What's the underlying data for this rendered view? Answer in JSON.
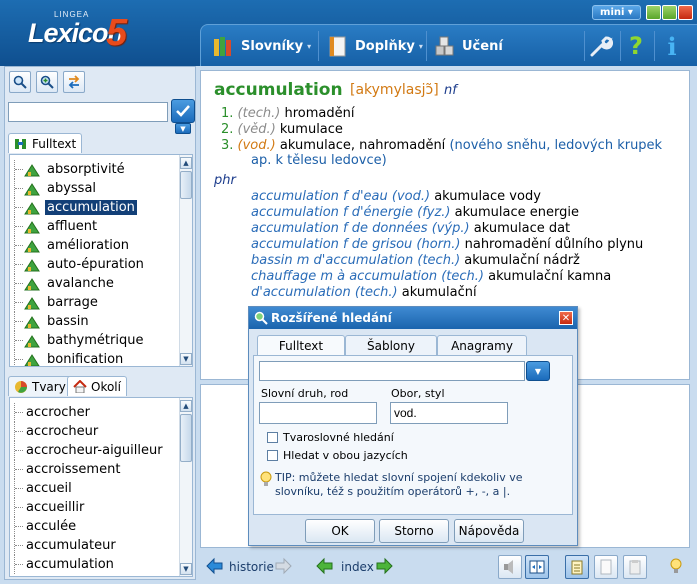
{
  "app": {
    "logo_sup": "LINGEA",
    "logo_word": "Lexicon",
    "logo_num": "5",
    "mini_label": "mini"
  },
  "menu": {
    "slovniky": "Slovníky",
    "doplnky": "Doplňky",
    "uceni": "Učení"
  },
  "left": {
    "search_value": "",
    "tab_fulltext": "Fulltext",
    "upper_words": [
      "absorptivité",
      "abyssal",
      "accumulation",
      "affluent",
      "amélioration",
      "auto-épuration",
      "avalanche",
      "barrage",
      "bassin",
      "bathymétrique",
      "bonification"
    ],
    "upper_selected": 2,
    "tab_tvary": "Tvary",
    "tab_okoli": "Okolí",
    "lower_words": [
      "accrocher",
      "accrocheur",
      "accrocheur-aiguilleur",
      "accroissement",
      "accueil",
      "accueillir",
      "acculée",
      "accumulateur",
      "accumulation"
    ]
  },
  "entry": {
    "headword": "accumulation",
    "pron": "[akymylasjɔ̃]",
    "gram": "nf",
    "senses": [
      {
        "num": "1.",
        "label": "(tech.)",
        "text": "hromadění",
        "note": ""
      },
      {
        "num": "2.",
        "label": "(věd.)",
        "text": "kumulace",
        "note": ""
      },
      {
        "num": "3.",
        "label": "(vod.)",
        "text": "akumulace, nahromadění",
        "note": "(nového sněhu, ledových krupek",
        "note2": "ap. k tělesu ledovce)"
      }
    ],
    "phr": "phr",
    "phrases": [
      {
        "fr": "accumulation f d'eau (vod.)",
        "cz": "akumulace vody"
      },
      {
        "fr": "accumulation f d'énergie (fyz.)",
        "cz": "akumulace energie"
      },
      {
        "fr": "accumulation f de données (výp.)",
        "cz": "akumulace dat"
      },
      {
        "fr": "accumulation f de grisou (horn.)",
        "cz": "nahromadění důlního plynu"
      },
      {
        "fr": "bassin m d'accumulation (tech.)",
        "cz": "akumulační nádrž"
      },
      {
        "fr": "chauffage m à accumulation (tech.)",
        "cz": "akumulační kamna"
      },
      {
        "fr": "d'accumulation (tech.)",
        "cz": "akumulační"
      }
    ]
  },
  "bottom": {
    "historie": "historie",
    "index": "index"
  },
  "dialog": {
    "title": "Rozšířené hledání",
    "tabs": [
      "Fulltext",
      "Šablony",
      "Anagramy"
    ],
    "main_value": "",
    "label_druh": "Slovní druh, rod",
    "label_obor": "Obor, styl",
    "druh_value": "",
    "obor_value": "vod.",
    "cb_tvaro": "Tvaroslovné hledání",
    "cb_oba": "Hledat v obou jazycích",
    "tip": "TIP: můžete hledat slovní spojení kdekoliv ve slovníku, též s použitím operátorů +, -, a |.",
    "ok": "OK",
    "storno": "Storno",
    "napoveda": "Nápověda"
  },
  "colors": {
    "header": "#1660a6",
    "headword": "#2b8f2b",
    "pron": "#d27a14",
    "selection": "#123f77"
  }
}
